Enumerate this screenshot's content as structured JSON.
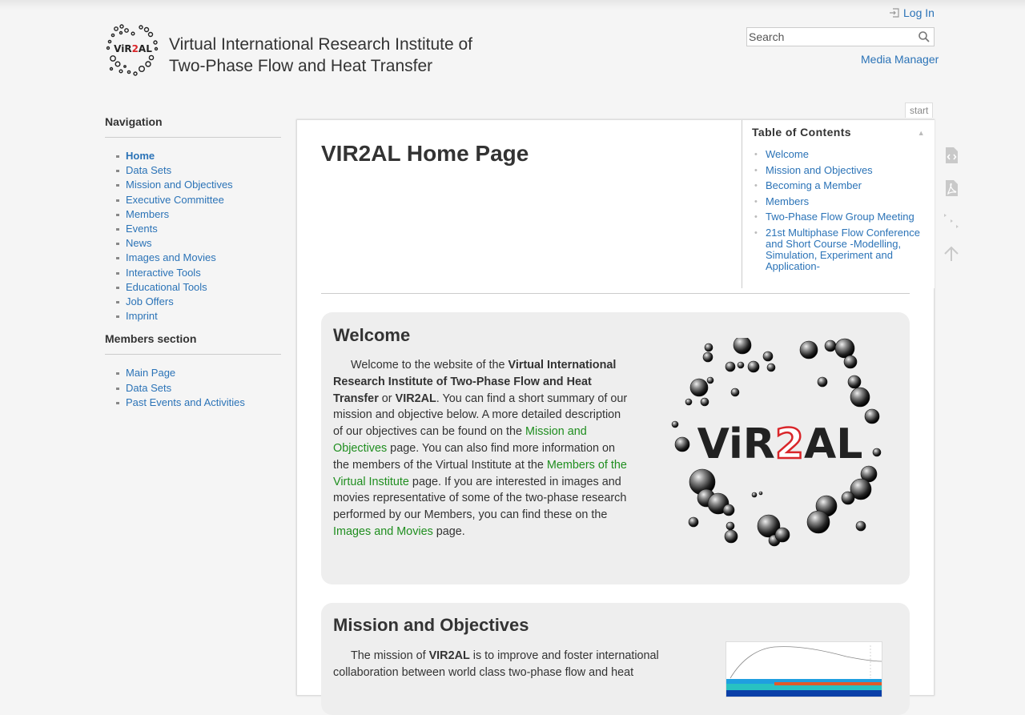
{
  "header": {
    "logo_text": "ViR2AL",
    "title_line1": "Virtual International Research Institute of",
    "title_line2": "Two-Phase Flow and Heat Transfer",
    "login_label": "Log In",
    "search_placeholder": "Search",
    "media_manager_label": "Media Manager",
    "login_icon": "login-icon",
    "search_icon": "magnifier-icon"
  },
  "sidebar": {
    "navigation_title": "Navigation",
    "nav_items": [
      {
        "label": "Home",
        "active": true
      },
      {
        "label": "Data Sets"
      },
      {
        "label": "Mission and Objectives"
      },
      {
        "label": "Executive Committee"
      },
      {
        "label": "Members"
      },
      {
        "label": "Events"
      },
      {
        "label": "News"
      },
      {
        "label": "Images and Movies"
      },
      {
        "label": "Interactive Tools"
      },
      {
        "label": "Educational Tools"
      },
      {
        "label": "Job Offers"
      },
      {
        "label": "Imprint"
      }
    ],
    "members_title": "Members section",
    "member_items": [
      {
        "label": "Main Page"
      },
      {
        "label": "Data Sets"
      },
      {
        "label": "Past Events and Activities"
      }
    ]
  },
  "page_tab": "start",
  "page": {
    "title": "VIR2AL Home Page"
  },
  "toc": {
    "title": "Table of Contents",
    "items": [
      "Welcome",
      "Mission and Objectives",
      "Becoming a Member",
      "Members",
      "Two-Phase Flow Group Meeting",
      "21st Multiphase Flow Conference and Short Course -Modelling, Simulation, Experiment and Application-"
    ]
  },
  "welcome": {
    "title": "Welcome",
    "p1": "Welcome to the website of the ",
    "b1": "Virtual International Research Institute of Two-Phase Flow and Heat Transfer",
    "p2": " or ",
    "b2": "VIR2AL",
    "p3": ". You can find a short summary of our mission and objective below. A more detailed description of our objectives can be found on the ",
    "l1": "Mission and Objectives",
    "p4": " page. You can also find more information on the members of the Virtual Institute at the ",
    "l2": "Members of the Virtual Institute",
    "p5": " page. If you are interested in images and movies representative of some of the two-phase research performed by our Members, you can find these on the ",
    "l3": "Images and Movies",
    "p6": " page.",
    "image_text": "ViR2AL"
  },
  "mission": {
    "title": "Mission and Objectives",
    "p1": "The mission of ",
    "b1": "VIR2AL",
    "p2": " is to improve and foster international collaboration between world class two-phase flow and heat"
  },
  "tools": [
    "show-source-icon",
    "pdf-icon",
    "backlinks-icon",
    "back-to-top-icon"
  ],
  "colors": {
    "link": "#2b73b7",
    "internal_link": "#1f8e1f",
    "background": "#f5f5f5",
    "section_bg": "#eeeeee",
    "logo_accent": "#d9262a"
  }
}
